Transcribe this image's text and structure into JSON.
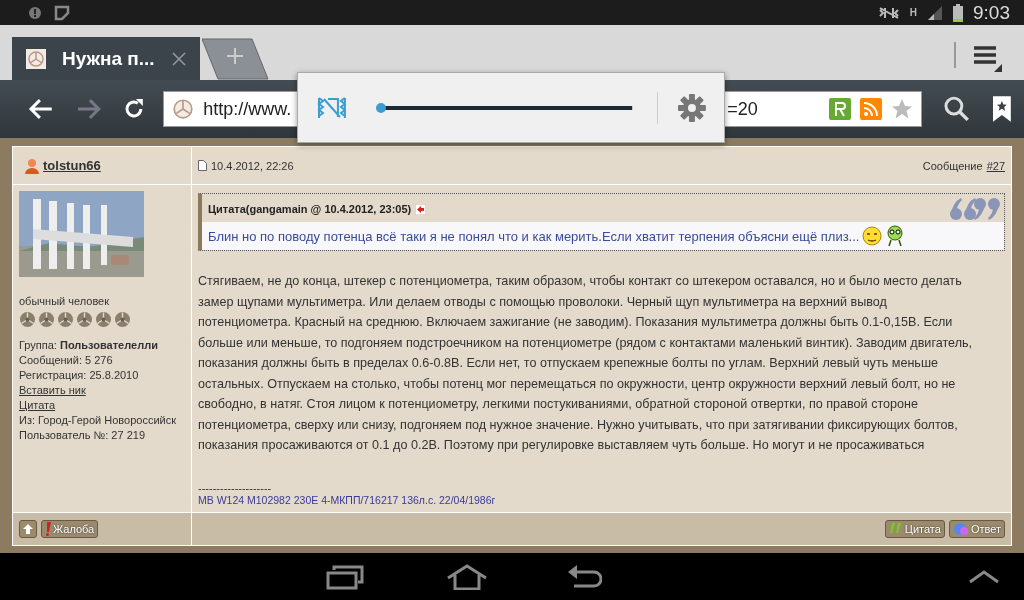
{
  "status_bar": {
    "network": "H",
    "time": "9:03"
  },
  "tabs": [
    {
      "title": "Нужна п...",
      "selected": true
    }
  ],
  "address_bar": {
    "url_start": "http://www.",
    "url_end": "=20"
  },
  "brightness_popup": {
    "level": 0.0
  },
  "post": {
    "author": "tolstun66",
    "date": "10.4.2012, 22:26",
    "message_label": "Сообщение",
    "message_number": "#27",
    "profile": {
      "title": "обычный человек",
      "stars": 6,
      "lines": [
        {
          "kind": "text",
          "text": "Группа: **Пользователелли**"
        },
        {
          "kind": "text",
          "text": "Сообщений: 5 276"
        },
        {
          "kind": "text",
          "text": "Регистрация: 25.8.2010"
        },
        {
          "kind": "link",
          "text": "Вставить ник"
        },
        {
          "kind": "link",
          "text": "Цитата"
        },
        {
          "kind": "text",
          "text": "Из: Город-Герой Новороссийск"
        },
        {
          "kind": "text",
          "text": "Пользователь №: 27 219"
        }
      ]
    },
    "quote": {
      "header": "Цитата(gangamain @ 10.4.2012, 23:05)",
      "text": "Блин но по поводу потенца всё таки я не понял что и как мерить.Если хватит терпения объясни ещё плиз..."
    },
    "body": "Стягиваем, не до конца, штекер с потенциометра, таким образом, чтобы контакт со штекером оставался, но и было место делать замер щупами мультиметра. Или делаем отводы с помощью проволоки. Черный щуп мультиметра на верхний вывод потенциометра. Красный на среднюю. Включаем зажигание (не заводим). Показания мультиметра должны быть 0.1-0,15В. Если больше или меньше, то подгоняем подстроечником на потенциометре (рядом с контактами маленький винтик). Заводим двигатель, показания должны быть в пределах 0.6-0.8В. Если нет, то отпускаем крепежные болты по углам. Верхний левый чуть меньше остальных. Отпускаем на столько, чтобы потенц мог перемещаться по окружности, центр окружности верхний левый болт, но не свободно, в натяг. Стоя лицом к потенциометру, легкими постукиваниями, обратной стороной отвертки, по правой стороне потенциометра, сверху или снизу, подгоняем под нужное значение. Нужно учитывать, что при затягивании фиксирующих болтов, показания просаживаются от 0.1 до 0.2В. Поэтому при регулировке выставляем чуть больше. Но могут и не просаживаться",
    "signature_rule": "--------------------",
    "signature": "MB W124 M102982 230E 4-МКПП/716217 136л.с. 22/04/1986г",
    "footer_left": [
      "Жалоба"
    ],
    "footer_right": [
      "Цитата",
      "Ответ"
    ]
  }
}
